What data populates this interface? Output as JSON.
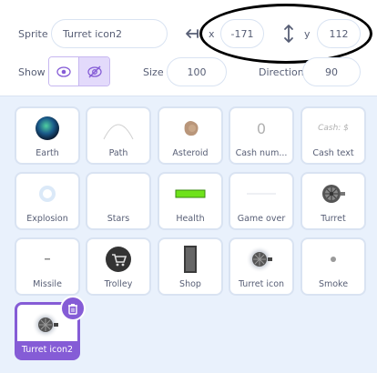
{
  "info": {
    "sprite_label": "Sprite",
    "sprite_name": "Turret icon2",
    "x_label": "x",
    "x_value": "-171",
    "y_label": "y",
    "y_value": "112",
    "show_label": "Show",
    "size_label": "Size",
    "size_value": "100",
    "direction_label": "Direction",
    "direction_value": "90"
  },
  "colors": {
    "accent": "#855cd6",
    "text": "#575e75",
    "panel_bg": "#e9f1fc"
  },
  "sprites": [
    {
      "name": "Earth",
      "icon": "earth-icon"
    },
    {
      "name": "Path",
      "icon": "path-arc-icon"
    },
    {
      "name": "Asteroid",
      "icon": "asteroid-icon"
    },
    {
      "name": "Cash num...",
      "icon": "digit-zero-icon",
      "thumb_text": "0"
    },
    {
      "name": "Cash text",
      "icon": "cash-text-icon",
      "thumb_text": "Cash: $"
    },
    {
      "name": "Explosion",
      "icon": "explosion-icon"
    },
    {
      "name": "Stars",
      "icon": "stars-icon"
    },
    {
      "name": "Health",
      "icon": "health-bar-icon"
    },
    {
      "name": "Game over",
      "icon": "game-over-icon"
    },
    {
      "name": "Turret",
      "icon": "turret-icon"
    },
    {
      "name": "Missile",
      "icon": "missile-icon"
    },
    {
      "name": "Trolley",
      "icon": "trolley-icon"
    },
    {
      "name": "Shop",
      "icon": "shop-icon"
    },
    {
      "name": "Turret icon",
      "icon": "turret-glow-icon"
    },
    {
      "name": "Smoke",
      "icon": "smoke-icon"
    },
    {
      "name": "Turret icon2",
      "icon": "turret-glow-icon",
      "selected": true
    }
  ]
}
